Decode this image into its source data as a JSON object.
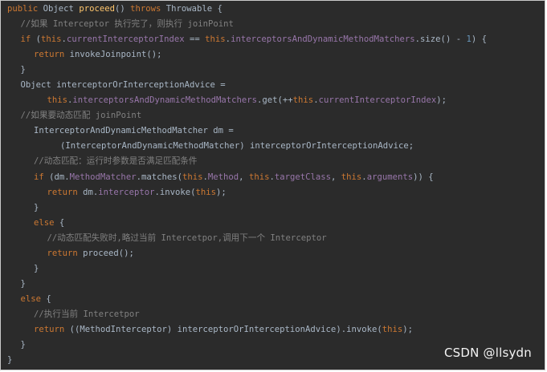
{
  "code": {
    "lines": [
      {
        "indent": 0,
        "tokens": [
          {
            "t": "public",
            "k": "kw"
          },
          {
            "t": " Object ",
            "k": "type"
          },
          {
            "t": "proceed",
            "k": "fn"
          },
          {
            "t": "() ",
            "k": "text"
          },
          {
            "t": "throws",
            "k": "kw"
          },
          {
            "t": " Throwable {",
            "k": "type"
          }
        ]
      },
      {
        "indent": 1,
        "tokens": [
          {
            "t": "//如果 Interceptor 执行完了，则执行 joinPoint",
            "k": "comment"
          }
        ]
      },
      {
        "indent": 1,
        "tokens": [
          {
            "t": "if",
            "k": "kw"
          },
          {
            "t": " (",
            "k": "text"
          },
          {
            "t": "this",
            "k": "kw"
          },
          {
            "t": ".",
            "k": "text"
          },
          {
            "t": "currentInterceptorIndex",
            "k": "field"
          },
          {
            "t": " == ",
            "k": "op"
          },
          {
            "t": "this",
            "k": "kw"
          },
          {
            "t": ".",
            "k": "text"
          },
          {
            "t": "interceptorsAndDynamicMethodMatchers",
            "k": "field"
          },
          {
            "t": ".size() - ",
            "k": "text"
          },
          {
            "t": "1",
            "k": "num"
          },
          {
            "t": ") {",
            "k": "text"
          }
        ]
      },
      {
        "indent": 2,
        "tokens": [
          {
            "t": "return",
            "k": "kw"
          },
          {
            "t": " invokeJoinpoint();",
            "k": "text"
          }
        ]
      },
      {
        "indent": 1,
        "tokens": [
          {
            "t": "}",
            "k": "text"
          }
        ]
      },
      {
        "indent": 1,
        "tokens": [
          {
            "t": "Object interceptorOrInterceptionAdvice =",
            "k": "text"
          }
        ]
      },
      {
        "indent": 3,
        "tokens": [
          {
            "t": "this",
            "k": "kw"
          },
          {
            "t": ".",
            "k": "text"
          },
          {
            "t": "interceptorsAndDynamicMethodMatchers",
            "k": "field"
          },
          {
            "t": ".get(++",
            "k": "text"
          },
          {
            "t": "this",
            "k": "kw"
          },
          {
            "t": ".",
            "k": "text"
          },
          {
            "t": "currentInterceptorIndex",
            "k": "field"
          },
          {
            "t": ");",
            "k": "text"
          }
        ]
      },
      {
        "indent": 1,
        "tokens": [
          {
            "t": "//如果要动态匹配 joinPoint",
            "k": "comment"
          }
        ]
      },
      {
        "indent": 2,
        "tokens": [
          {
            "t": "InterceptorAndDynamicMethodMatcher dm =",
            "k": "text"
          }
        ]
      },
      {
        "indent": 4,
        "tokens": [
          {
            "t": "(InterceptorAndDynamicMethodMatcher) interceptorOrInterceptionAdvice;",
            "k": "text"
          }
        ]
      },
      {
        "indent": 2,
        "tokens": [
          {
            "t": "//动态匹配：运行时参数是否满足匹配条件",
            "k": "comment"
          }
        ]
      },
      {
        "indent": 2,
        "tokens": [
          {
            "t": "if",
            "k": "kw"
          },
          {
            "t": " (dm.",
            "k": "text"
          },
          {
            "t": "MethodMatcher",
            "k": "field"
          },
          {
            "t": ".matches(",
            "k": "text"
          },
          {
            "t": "this",
            "k": "kw"
          },
          {
            "t": ".",
            "k": "text"
          },
          {
            "t": "Method",
            "k": "field"
          },
          {
            "t": ", ",
            "k": "text"
          },
          {
            "t": "this",
            "k": "kw"
          },
          {
            "t": ".",
            "k": "text"
          },
          {
            "t": "targetClass",
            "k": "field"
          },
          {
            "t": ", ",
            "k": "text"
          },
          {
            "t": "this",
            "k": "kw"
          },
          {
            "t": ".",
            "k": "text"
          },
          {
            "t": "arguments",
            "k": "field"
          },
          {
            "t": ")) {",
            "k": "text"
          }
        ]
      },
      {
        "indent": 3,
        "tokens": [
          {
            "t": "return",
            "k": "kw"
          },
          {
            "t": " dm.",
            "k": "text"
          },
          {
            "t": "interceptor",
            "k": "field"
          },
          {
            "t": ".invoke(",
            "k": "text"
          },
          {
            "t": "this",
            "k": "kw"
          },
          {
            "t": ");",
            "k": "text"
          }
        ]
      },
      {
        "indent": 2,
        "tokens": [
          {
            "t": "}",
            "k": "text"
          }
        ]
      },
      {
        "indent": 2,
        "tokens": [
          {
            "t": "else",
            "k": "kw"
          },
          {
            "t": " {",
            "k": "text"
          }
        ]
      },
      {
        "indent": 3,
        "tokens": [
          {
            "t": "//动态匹配失败时,略过当前 Intercetpor,调用下一个 Interceptor",
            "k": "comment"
          }
        ]
      },
      {
        "indent": 3,
        "tokens": [
          {
            "t": "return",
            "k": "kw"
          },
          {
            "t": " proceed();",
            "k": "text"
          }
        ]
      },
      {
        "indent": 2,
        "tokens": [
          {
            "t": "}",
            "k": "text"
          }
        ]
      },
      {
        "indent": 1,
        "tokens": [
          {
            "t": "}",
            "k": "text"
          }
        ]
      },
      {
        "indent": 1,
        "tokens": [
          {
            "t": "else",
            "k": "kw"
          },
          {
            "t": " {",
            "k": "text"
          }
        ]
      },
      {
        "indent": 2,
        "tokens": [
          {
            "t": "//执行当前 Intercetpor",
            "k": "comment"
          }
        ]
      },
      {
        "indent": 2,
        "tokens": [
          {
            "t": "return",
            "k": "kw"
          },
          {
            "t": " ((MethodInterceptor) interceptorOrInterceptionAdvice).invoke(",
            "k": "text"
          },
          {
            "t": "this",
            "k": "kw"
          },
          {
            "t": ");",
            "k": "text"
          }
        ]
      },
      {
        "indent": 1,
        "tokens": [
          {
            "t": "}",
            "k": "text"
          }
        ]
      },
      {
        "indent": 0,
        "tokens": [
          {
            "t": "}",
            "k": "text"
          }
        ]
      }
    ]
  },
  "watermark": {
    "text": "CSDN @llsydn"
  },
  "colors": {
    "background": "#2b2b2b",
    "keyword": "#cc7832",
    "method_name": "#ffc66d",
    "field": "#9876aa",
    "number": "#6897bb",
    "comment": "#808080",
    "default_text": "#a9b7c6",
    "watermark": "#ffffff"
  }
}
